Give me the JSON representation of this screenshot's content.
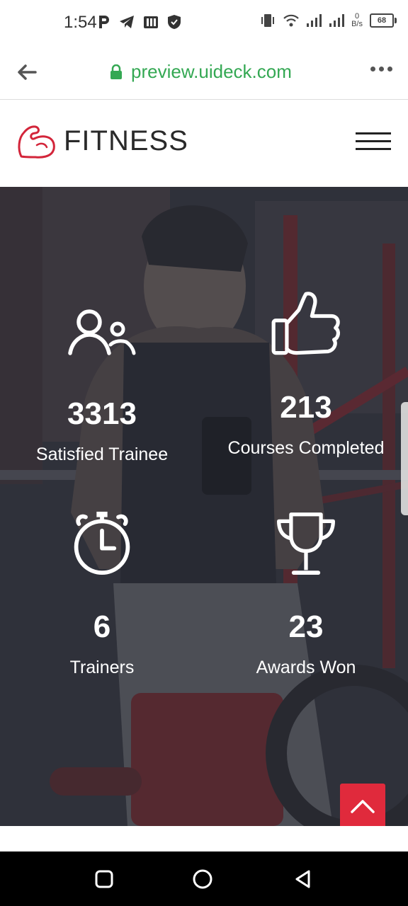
{
  "status_bar": {
    "time": "1:54",
    "net_speed_value": "0",
    "net_speed_unit": "B/s",
    "battery": "68"
  },
  "browser": {
    "url": "preview.uideck.com"
  },
  "header": {
    "logo_text": "FITNESS"
  },
  "stats": [
    {
      "icon": "users-icon",
      "value": "3313",
      "label": "Satisfied Trainee"
    },
    {
      "icon": "thumbs-up-icon",
      "value": "213",
      "label": "Courses Completed"
    },
    {
      "icon": "stopwatch-icon",
      "value": "6",
      "label": "Trainers"
    },
    {
      "icon": "trophy-icon",
      "value": "23",
      "label": "Awards Won"
    }
  ],
  "colors": {
    "accent": "#e02a3c",
    "url_green": "#34a853",
    "overlay": "#262832"
  }
}
